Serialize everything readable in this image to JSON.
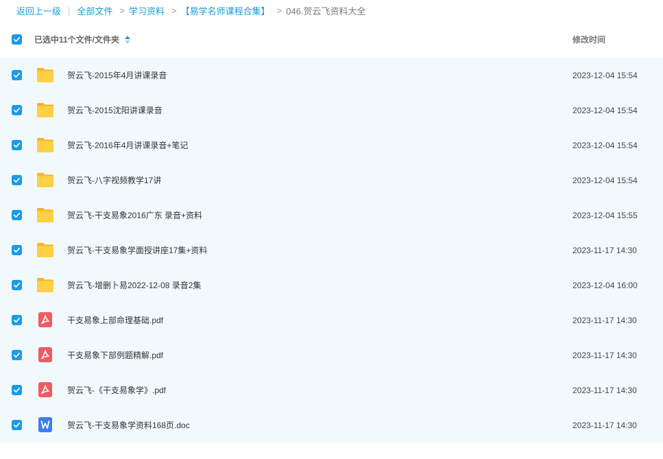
{
  "breadcrumb": {
    "back": "返回上一级",
    "all_files": "全部文件",
    "study": "学习资料",
    "collection": "【易学名师课程合集】",
    "current": "046.贺云飞资料大全"
  },
  "header": {
    "selected_label": "已选中11个文件/文件夹",
    "time_header": "修改时间"
  },
  "colors": {
    "accent": "#1a9be8",
    "folder": "#ffc83d",
    "pdf": "#ef5b62",
    "doc": "#3b7df2",
    "row_bg": "#f2f9fd"
  },
  "files": [
    {
      "name": "贺云飞-2015年4月讲课录音",
      "time": "2023-12-04 15:54",
      "type": "folder"
    },
    {
      "name": "贺云飞-2015沈阳讲课录音",
      "time": "2023-12-04 15:54",
      "type": "folder"
    },
    {
      "name": "贺云飞-2016年4月讲课录音+笔记",
      "time": "2023-12-04 15:54",
      "type": "folder"
    },
    {
      "name": "贺云飞-八字视频教学17讲",
      "time": "2023-12-04 15:54",
      "type": "folder"
    },
    {
      "name": "贺云飞-干支易象2016广东 录音+资料",
      "time": "2023-12-04 15:55",
      "type": "folder"
    },
    {
      "name": "贺云飞-干支易象学面授讲座17集+资料",
      "time": "2023-11-17 14:30",
      "type": "folder"
    },
    {
      "name": "贺云飞-增删卜易2022-12-08 录音2集",
      "time": "2023-12-04 16:00",
      "type": "folder"
    },
    {
      "name": "干支易象上部命理基础.pdf",
      "time": "2023-11-17 14:30",
      "type": "pdf"
    },
    {
      "name": "干支易象下部例题精解.pdf",
      "time": "2023-11-17 14:30",
      "type": "pdf"
    },
    {
      "name": "贺云飞-《干支易象学》.pdf",
      "time": "2023-11-17 14:30",
      "type": "pdf"
    },
    {
      "name": "贺云飞-干支易象学资料168页.doc",
      "time": "2023-11-17 14:30",
      "type": "doc"
    }
  ]
}
